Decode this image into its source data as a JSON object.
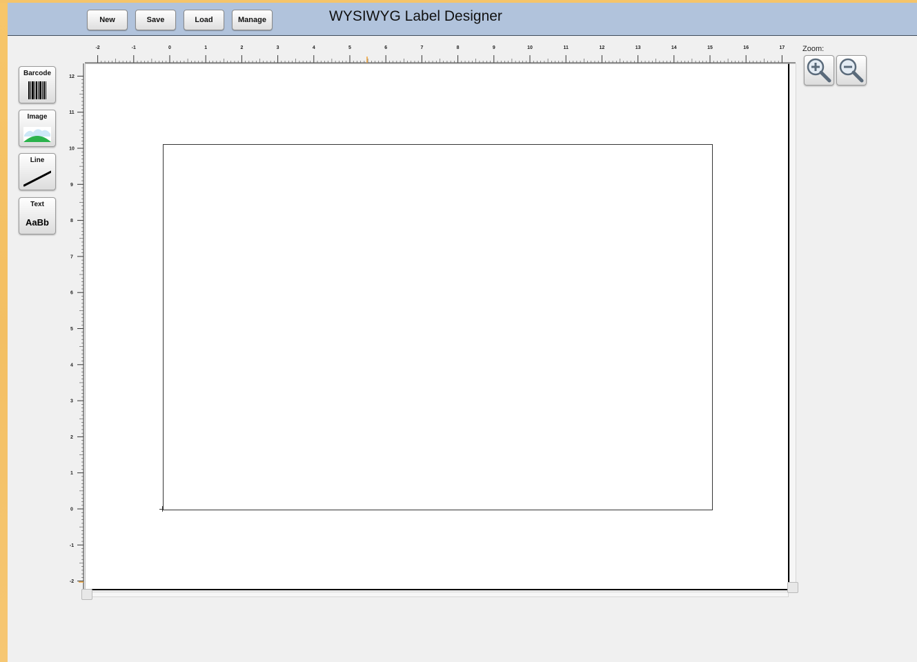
{
  "app": {
    "title": "WYSIWYG Label Designer"
  },
  "toolbar": {
    "new_label": "New",
    "save_label": "Save",
    "load_label": "Load",
    "manage_label": "Manage"
  },
  "tools": {
    "barcode_label": "Barcode",
    "image_label": "Image",
    "line_label": "Line",
    "text_label": "Text",
    "text_sample": "AaBb"
  },
  "zoom": {
    "label": "Zoom:"
  },
  "ruler": {
    "x_ticks": [
      -2,
      -1,
      0,
      1,
      2,
      3,
      4,
      5,
      6,
      7,
      8,
      9,
      10,
      11,
      12,
      13,
      14,
      15,
      16,
      17
    ],
    "y_ticks": [
      12,
      11,
      10,
      9,
      8,
      7,
      6,
      5,
      4,
      3,
      2,
      1,
      0,
      -1,
      -2
    ]
  },
  "colors": {
    "header": "#b1c3dc",
    "stripe": "#f5c46a",
    "ruler_marker": "#f0a030",
    "image_hill": "#2bb24c",
    "image_sky": "#4aa3e0"
  }
}
